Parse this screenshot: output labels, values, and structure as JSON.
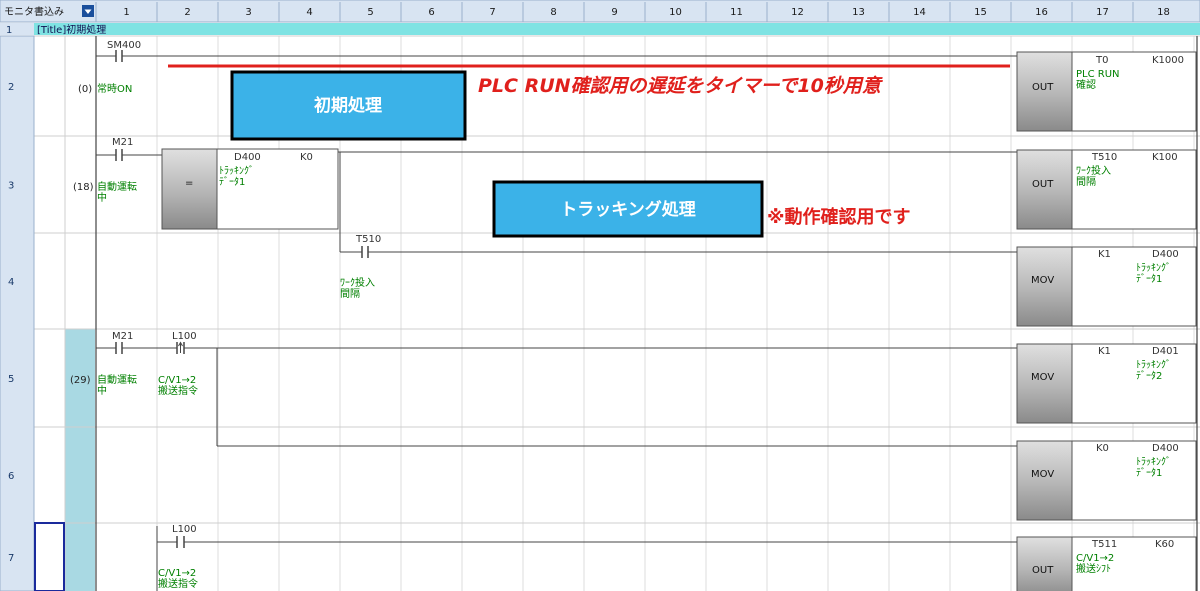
{
  "header": {
    "mode_label": "モニタ書込み",
    "columns": [
      "1",
      "2",
      "3",
      "4",
      "5",
      "6",
      "7",
      "8",
      "9",
      "10",
      "11",
      "12",
      "13",
      "14",
      "15",
      "16",
      "17",
      "18"
    ]
  },
  "title_row": {
    "row_number": "1",
    "text": "[Title]初期処理"
  },
  "rows": [
    {
      "row_number": "2",
      "step": "(0)",
      "contacts": [
        {
          "device": "SM400",
          "comment": "常時ON"
        }
      ],
      "instruction": {
        "label": "OUT",
        "operand1": "T0",
        "operand2": "K1000",
        "comment": "PLC RUN\n確認"
      }
    },
    {
      "row_number": "3",
      "step": "(18)",
      "contacts": [
        {
          "device": "M21",
          "comment": "自動運転\n中"
        }
      ],
      "compare": {
        "label": "=",
        "operand1": "D400",
        "operand2": "K0",
        "comment": "ﾄﾗｯｷﾝｸﾞ\nﾃﾞｰﾀ1"
      },
      "instruction": {
        "label": "OUT",
        "operand1": "T510",
        "operand2": "K100",
        "comment": "ﾜｰｸ投入\n間隔"
      }
    },
    {
      "row_number": "4",
      "contacts": [
        {
          "device": "T510",
          "comment": "ﾜｰｸ投入\n間隔"
        }
      ],
      "instruction": {
        "label": "MOV",
        "operand1": "K1",
        "operand2": "D400",
        "comment": "ﾄﾗｯｷﾝｸﾞ\nﾃﾞｰﾀ1"
      }
    },
    {
      "row_number": "5",
      "step": "(29)",
      "contacts": [
        {
          "device": "M21",
          "comment": "自動運転\n中"
        },
        {
          "device": "L100",
          "comment": "C/V1→2\n搬送指令"
        }
      ],
      "instruction": {
        "label": "MOV",
        "operand1": "K1",
        "operand2": "D401",
        "comment": "ﾄﾗｯｷﾝｸﾞ\nﾃﾞｰﾀ2"
      }
    },
    {
      "row_number": "6",
      "instruction": {
        "label": "MOV",
        "operand1": "K0",
        "operand2": "D400",
        "comment": "ﾄﾗｯｷﾝｸﾞ\nﾃﾞｰﾀ1"
      }
    },
    {
      "row_number": "7",
      "contacts": [
        {
          "device": "L100",
          "comment": "C/V1→2\n搬送指令"
        }
      ],
      "instruction": {
        "label": "OUT",
        "operand1": "T511",
        "operand2": "K60",
        "comment": "C/V1→2\n搬送ｼﾌﾄ"
      }
    }
  ],
  "annotations": {
    "box1": "初期処理",
    "box2": "トラッキング処理",
    "note1": "PLC RUN確認用の遅延をタイマーで10秒用意",
    "note2": "※動作確認用です"
  },
  "colors": {
    "header_bg": "#d8e4f2",
    "title_bg": "#7fe3e3",
    "box_bg": "#3bb2e8",
    "box_border": "#000000",
    "red": "#e0201c",
    "comment_green": "#008000",
    "button_bg": "#b8b8b8",
    "step_column_bg": "#a9d9e3"
  }
}
